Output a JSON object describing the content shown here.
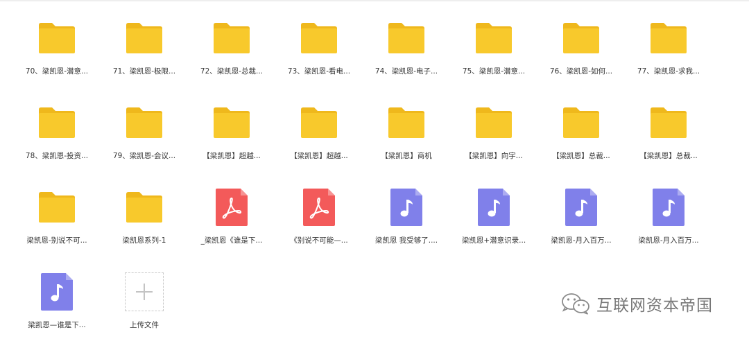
{
  "files": [
    {
      "name": "70、梁凯恩-潜意...",
      "type": "folder"
    },
    {
      "name": "71、梁凯恩-极限...",
      "type": "folder"
    },
    {
      "name": "72、梁凯恩-总裁...",
      "type": "folder"
    },
    {
      "name": "73、梁凯恩-看电...",
      "type": "folder"
    },
    {
      "name": "74、梁凯恩-电子...",
      "type": "folder"
    },
    {
      "name": "75、梁凯恩-潜意...",
      "type": "folder"
    },
    {
      "name": "76、梁凯恩-如何...",
      "type": "folder"
    },
    {
      "name": "77、梁凯恩-求我...",
      "type": "folder"
    },
    {
      "name": "78、梁凯恩-投资...",
      "type": "folder"
    },
    {
      "name": "79、梁凯恩-会议...",
      "type": "folder"
    },
    {
      "name": "【梁凯恩】超越...",
      "type": "folder"
    },
    {
      "name": "【梁凯恩】超越...",
      "type": "folder"
    },
    {
      "name": "【梁凯恩】商机",
      "type": "folder"
    },
    {
      "name": "【梁凯恩】向宇...",
      "type": "folder"
    },
    {
      "name": "【梁凯恩】总裁...",
      "type": "folder"
    },
    {
      "name": "【梁凯恩】总裁...",
      "type": "folder"
    },
    {
      "name": "梁凯恩-别说不可...",
      "type": "folder"
    },
    {
      "name": "梁凯恩系列-1",
      "type": "folder"
    },
    {
      "name": "_梁凯恩《谁是下...",
      "type": "pdf"
    },
    {
      "name": "《别说不可能—...",
      "type": "pdf"
    },
    {
      "name": "梁凯恩 我受够了....",
      "type": "audio"
    },
    {
      "name": "梁凯恩+潜意识录...",
      "type": "audio"
    },
    {
      "name": "梁凯恩-月入百万...",
      "type": "audio"
    },
    {
      "name": "梁凯恩-月入百万...",
      "type": "audio"
    },
    {
      "name": "梁凯恩—谁是下...",
      "type": "audio"
    }
  ],
  "upload": {
    "label": "上传文件",
    "icon": "plus-icon"
  },
  "watermark": {
    "text": "互联网资本帝国",
    "icon": "wechat-icon"
  },
  "colors": {
    "folder": "#f8c92c",
    "folder_tab": "#efb81c",
    "pdf": "#f35a5a",
    "audio": "#8080ea",
    "text": "#333333"
  }
}
